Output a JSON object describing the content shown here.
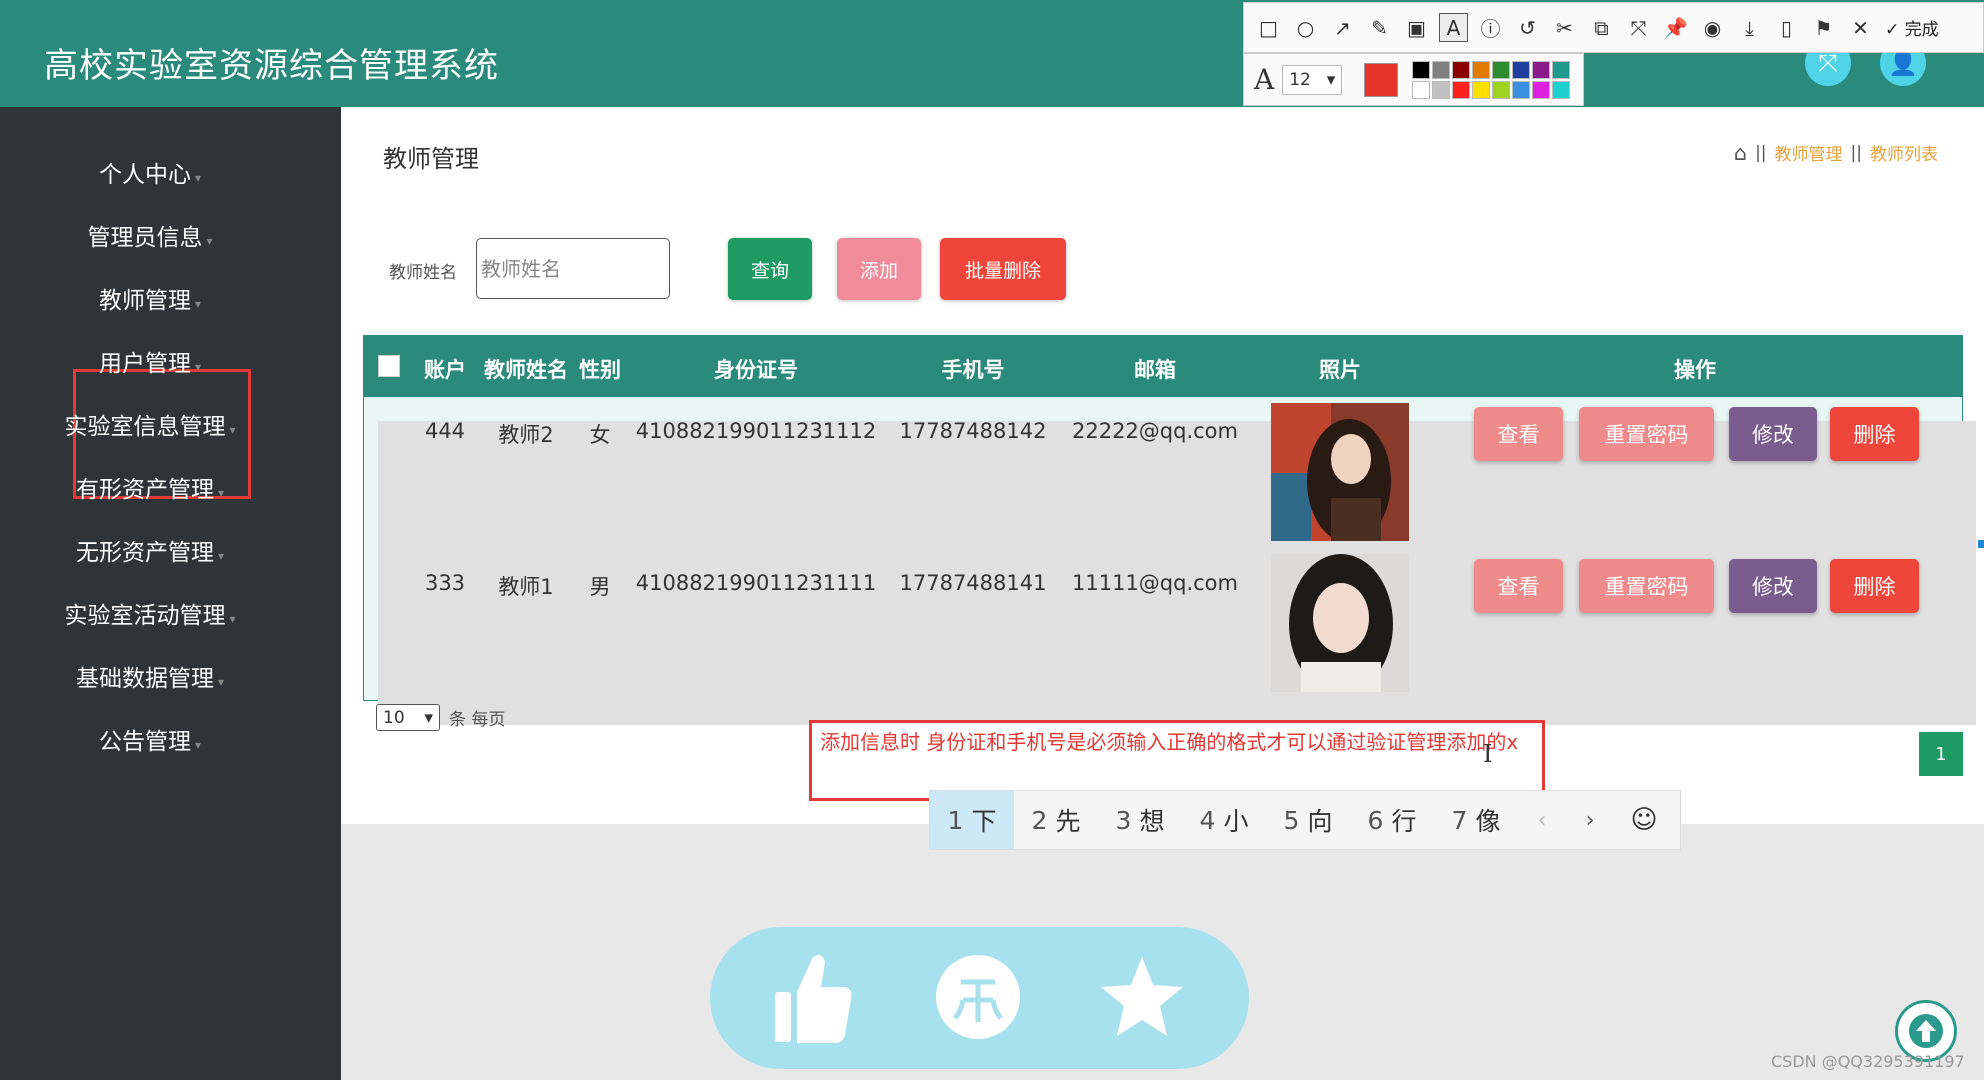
{
  "header": {
    "title": "高校实验室资源综合管理系统"
  },
  "snip_toolbar": {
    "tools": [
      "□",
      "○",
      "↗",
      "✎",
      "▣",
      "A",
      "ⓘ",
      "↺",
      "✂",
      "⧉",
      "⤧",
      "📌",
      "◉",
      "⤓",
      "▯",
      "⚑",
      "✕"
    ],
    "done_label": "✓ 完成",
    "font_label": "A",
    "font_size": "12",
    "current_color": "#e8322c",
    "palette": [
      "#000000",
      "#808080",
      "#8b0000",
      "#e07b00",
      "#2e8b2e",
      "#1e3fa0",
      "#8b1a8b",
      "#1e9a8c",
      "#ffffff",
      "#c0c0c0",
      "#ff2020",
      "#ffe000",
      "#9bd31e",
      "#3a8fe0",
      "#e020e0",
      "#20d0d0"
    ]
  },
  "sidebar": {
    "items": [
      "个人中心",
      "管理员信息",
      "教师管理",
      "用户管理",
      "实验室信息管理",
      "有形资产管理",
      "无形资产管理",
      "实验室活动管理",
      "基础数据管理",
      "公告管理"
    ]
  },
  "main": {
    "page_title": "教师管理",
    "breadcrumb": [
      "教师管理",
      "教师列表"
    ],
    "search": {
      "label": "教师姓名",
      "placeholder": "教师姓名"
    },
    "buttons": {
      "query": "查询",
      "add": "添加",
      "batch_delete": "批量删除"
    },
    "table": {
      "columns": [
        "账户",
        "教师姓名",
        "性别",
        "身份证号",
        "手机号",
        "邮箱",
        "照片",
        "操作"
      ],
      "rows": [
        {
          "account": "444",
          "name": "教师2",
          "gender": "女",
          "id_card": "410882199011231112",
          "phone": "17787488142",
          "email": "22222@qq.com"
        },
        {
          "account": "333",
          "name": "教师1",
          "gender": "男",
          "id_card": "410882199011231111",
          "phone": "17787488141",
          "email": "11111@qq.com"
        }
      ],
      "actions": {
        "view": "查看",
        "reset_password": "重置密码",
        "edit": "修改",
        "delete": "删除"
      }
    },
    "pagination": {
      "page_size": "10",
      "per_page_label": "条 每页",
      "current_page": "1"
    }
  },
  "annotation": {
    "text": "添加信息时 身份证和手机号是必须输入正确的格式才可以通过验证管理添加的x"
  },
  "ime": {
    "candidates": [
      {
        "n": "1",
        "c": "下"
      },
      {
        "n": "2",
        "c": "先"
      },
      {
        "n": "3",
        "c": "想"
      },
      {
        "n": "4",
        "c": "小"
      },
      {
        "n": "5",
        "c": "向"
      },
      {
        "n": "6",
        "c": "行"
      },
      {
        "n": "7",
        "c": "像"
      }
    ]
  },
  "social": {
    "icons": [
      "thumbs-up-icon",
      "coin-icon",
      "star-icon"
    ],
    "color": "#a8e1ee"
  },
  "watermark": "CSDN @QQ3295391197"
}
